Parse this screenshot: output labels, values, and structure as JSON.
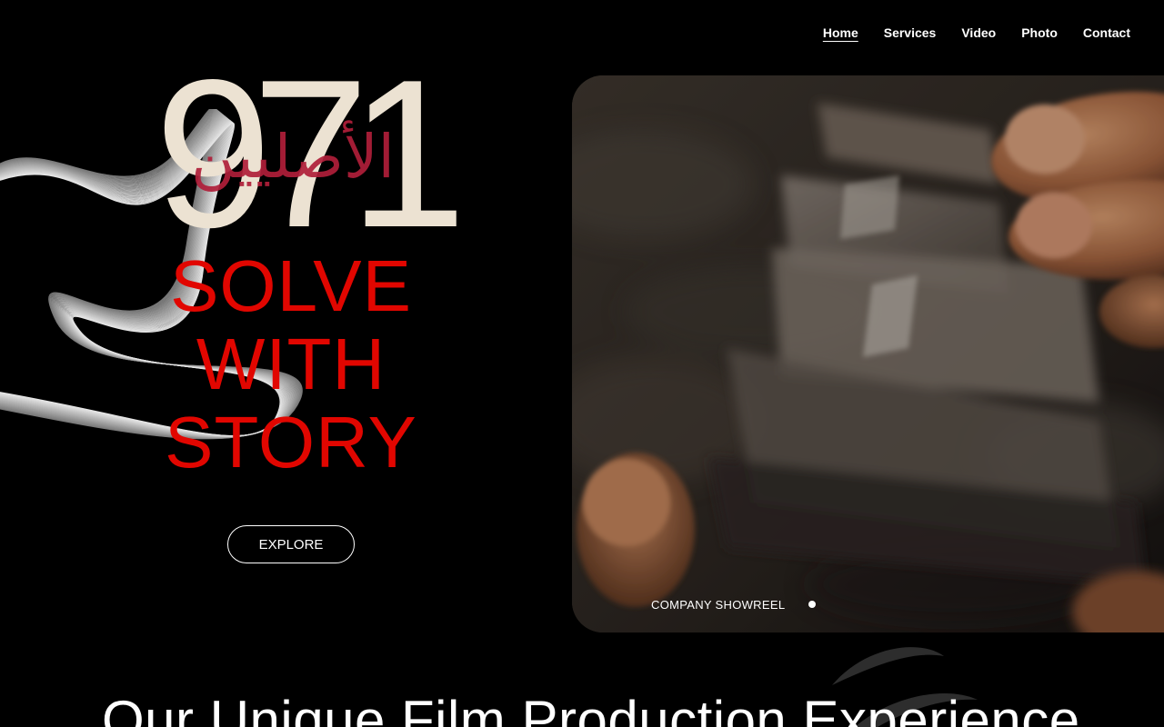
{
  "nav": {
    "items": [
      {
        "label": "Home",
        "active": true
      },
      {
        "label": "Services",
        "active": false
      },
      {
        "label": "Video",
        "active": false
      },
      {
        "label": "Photo",
        "active": false
      },
      {
        "label": "Contact",
        "active": false
      }
    ]
  },
  "logo": {
    "number": "971",
    "arabic": "الأصليين"
  },
  "hero": {
    "line1": "SOLVE",
    "line2": "WITH",
    "line3": "STORY",
    "cta_label": "EXPLORE"
  },
  "video": {
    "caption": "COMPANY SHOWREEL"
  },
  "section": {
    "heading": "Our Unique Film Production Experience"
  },
  "colors": {
    "background": "#000000",
    "headline_red": "#e10600",
    "logo_cream": "#ece2d2",
    "arabic_crimson": "#b01f3a",
    "text": "#ffffff"
  }
}
